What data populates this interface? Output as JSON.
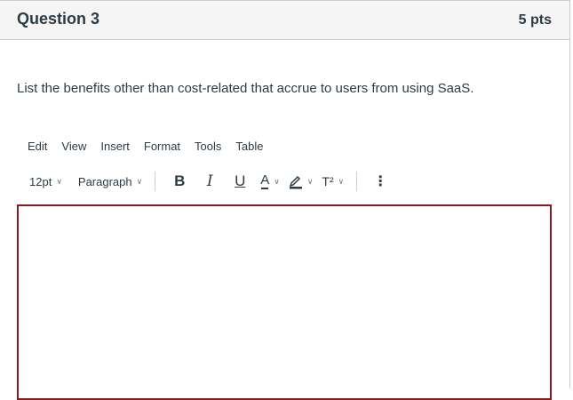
{
  "question": {
    "title": "Question 3",
    "points": "5 pts",
    "prompt": "List the benefits other than cost-related that accrue to users from using SaaS."
  },
  "menubar": [
    "Edit",
    "View",
    "Insert",
    "Format",
    "Tools",
    "Table"
  ],
  "toolbar": {
    "font_size": "12pt",
    "block_format": "Paragraph",
    "bold": "B",
    "italic": "I",
    "underline": "U",
    "text_color": "A",
    "superscript": "T²",
    "more": "⋮"
  },
  "editor": {
    "value": ""
  },
  "colors": {
    "editor_border": "#8b1a1a",
    "header_bg": "#f5f5f5",
    "text": "#2d3b45"
  }
}
